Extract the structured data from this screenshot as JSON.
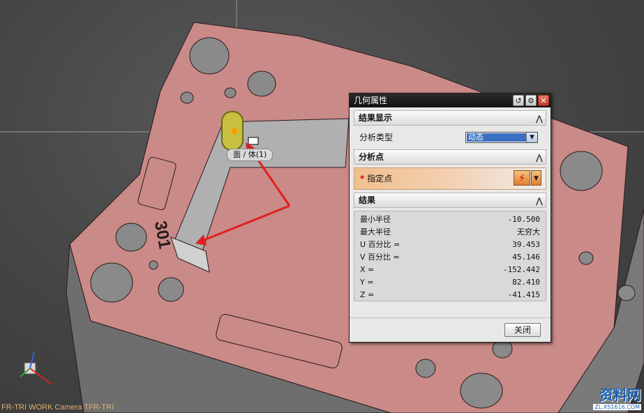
{
  "viewport": {
    "tooltip_text": "面 / 体(1)",
    "camera_label": "FR-TRI WORK Camera TFR-TRI",
    "part_label": "301",
    "watermark_title": "资料网",
    "watermark_url": "ZL.XS1616.COM",
    "colors": {
      "face": "#c98a88",
      "face_dark": "#a86a68",
      "edge": "#2a1a1a",
      "highlight": "#c8c040",
      "arrow": "#e02020"
    }
  },
  "dialog": {
    "title": "几何属性",
    "title_buttons": [
      "↺",
      "⚙",
      "✕"
    ],
    "section_display": {
      "label": "结果显示",
      "collapse": "⋀"
    },
    "analysis_type": {
      "label": "分析类型",
      "value": "动态"
    },
    "section_point": {
      "label": "分析点",
      "collapse": "⋀"
    },
    "specify_point": {
      "required_mark": "*",
      "label": "指定点"
    },
    "section_results": {
      "label": "结果",
      "collapse": "⋀"
    },
    "results": [
      {
        "label": "最小半径",
        "value": "-10.500"
      },
      {
        "label": "最大半径",
        "value": "无穷大"
      },
      {
        "label": "U 百分比 =",
        "value": "39.453"
      },
      {
        "label": "V 百分比 =",
        "value": "45.146"
      },
      {
        "label": "X =",
        "value": "-152.442"
      },
      {
        "label": "Y =",
        "value": "82.410"
      },
      {
        "label": "Z =",
        "value": "-41.415"
      }
    ],
    "close_label": "关闭"
  }
}
